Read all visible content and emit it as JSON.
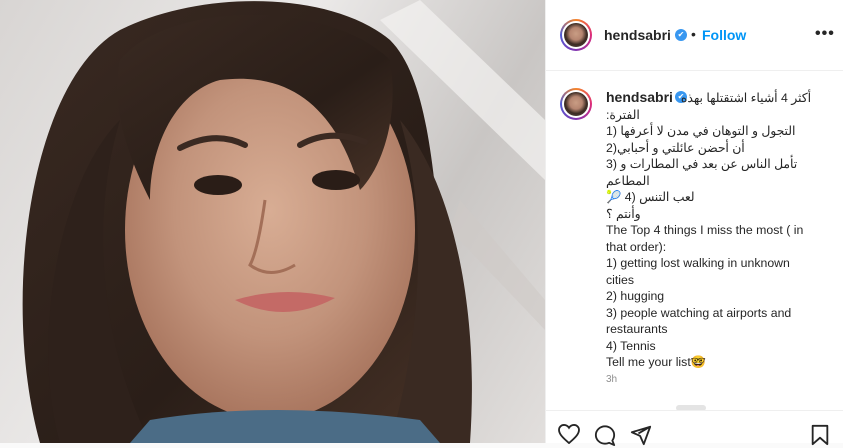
{
  "post": {
    "username": "hendsabri",
    "verified_icon": "✔",
    "dot": "•",
    "follow_label": "Follow",
    "more_icon": "•••",
    "caption_username": "hendsabri",
    "caption_lines": [
      "أكثر 4 أشياء اشتقتلها بهذه",
      "الفترة:",
      "التجول و التوهان في مدن لا أعرفها (1",
      "أن أحضن عائلتي و أحبابي(2",
      "تأمل الناس عن بعد في المطارات و (3",
      "المطاعم",
      "لعب التنس (4 🎾",
      "وأنتم ؟",
      "The Top 4 things I miss the most ( in",
      "that order):",
      "1) getting lost walking in unknown",
      "cities",
      "2) hugging",
      "3) people watching at airports and",
      "restaurants",
      "4) Tennis",
      "Tell me your list🤓"
    ],
    "time_ago": "3h"
  },
  "icons": [
    "heart-icon",
    "comment-icon",
    "share-icon",
    "bookmark-icon",
    "ellipsis-icon",
    "verified-icon"
  ],
  "colors": {
    "accent": "#0095f6",
    "verified": "#3897f0",
    "text": "#262626",
    "muted": "#8e8e8e"
  }
}
